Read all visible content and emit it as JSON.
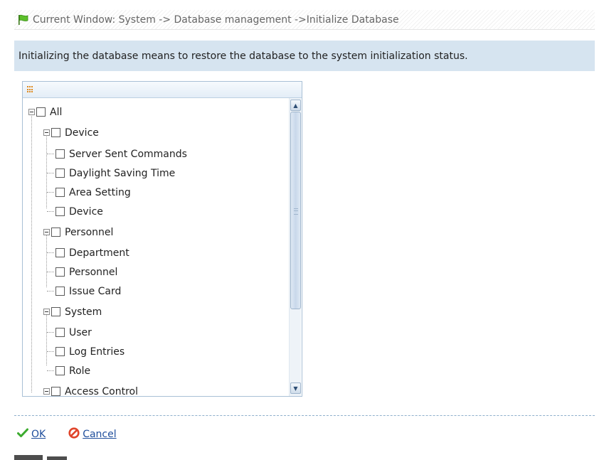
{
  "breadcrumb": {
    "icon": "green-flag-icon",
    "text": "Current Window: System -> Database management ->Initialize Database"
  },
  "notice": {
    "text": "Initializing the database means to restore the database to the system initialization status."
  },
  "tree": {
    "header_icon": "grid-icon",
    "root": "All",
    "groups": [
      {
        "label": "Device",
        "children": [
          "Server Sent Commands",
          "Daylight Saving Time",
          "Area Setting",
          "Device"
        ]
      },
      {
        "label": "Personnel",
        "children": [
          "Department",
          "Personnel",
          "Issue Card"
        ]
      },
      {
        "label": "System",
        "children": [
          "User",
          "Log Entries",
          "Role"
        ]
      },
      {
        "label": "Access Control",
        "children": []
      }
    ]
  },
  "actions": {
    "ok_label": "OK",
    "cancel_label": "Cancel"
  },
  "colors": {
    "notice_bg": "#d6e4f0",
    "link": "#1f4e9c",
    "ok_icon": "#3bab2e",
    "cancel_icon": "#e0452b"
  }
}
